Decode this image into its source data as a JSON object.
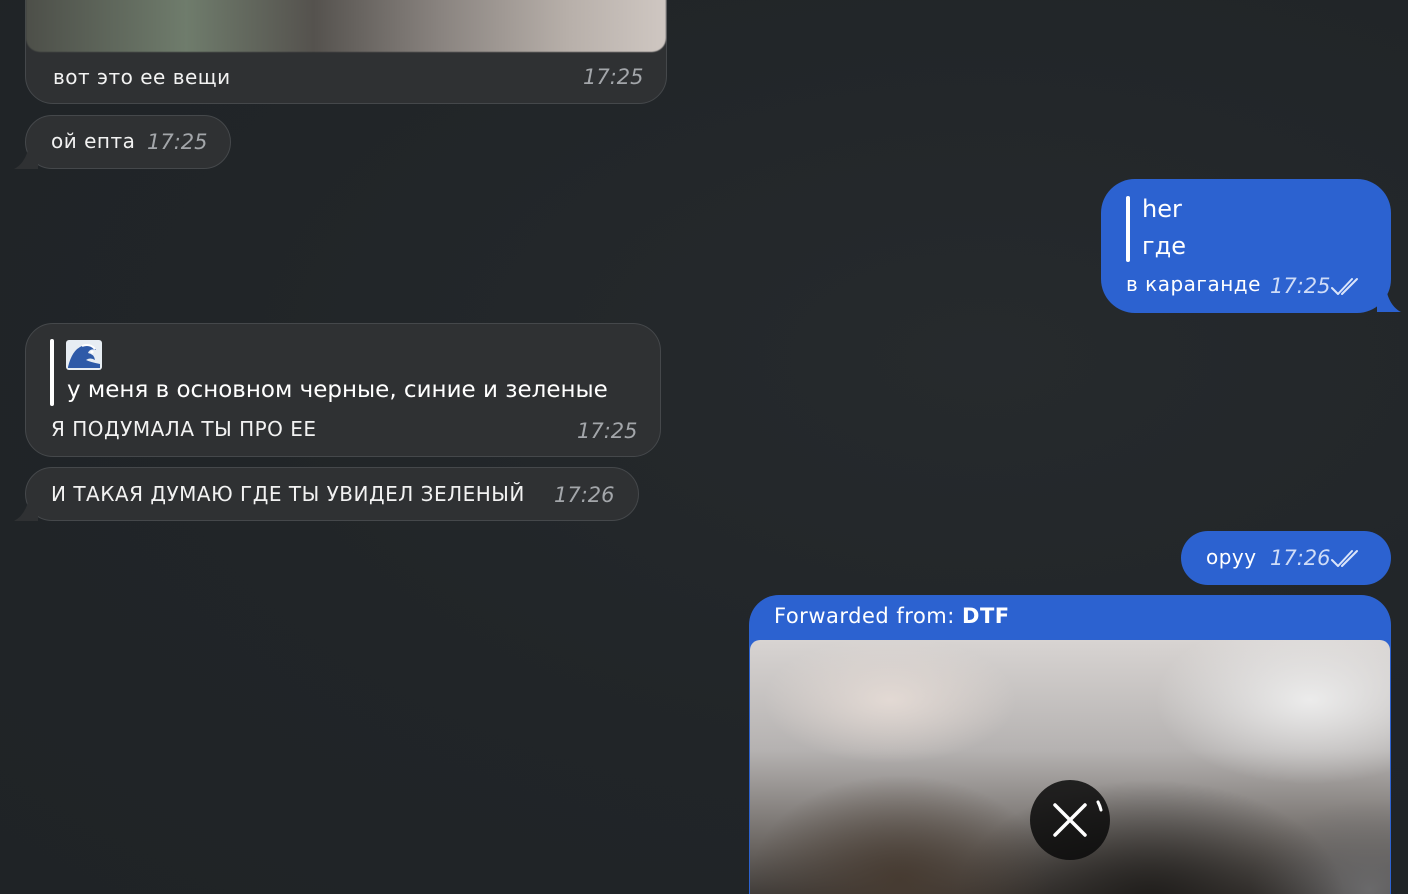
{
  "messages": {
    "m1": {
      "text": "вот это ее вещи",
      "time": "17:25"
    },
    "m2": {
      "text": "ой епта",
      "time": "17:25"
    },
    "m3": {
      "quote_title": "her",
      "quote_text": "где",
      "text": "в караганде",
      "time": "17:25"
    },
    "m4": {
      "quote_title": "🌊",
      "quote_text": "у меня в основном черные, синие и зеленые",
      "text": "Я ПОДУМАЛА ТЫ ПРО ЕЕ",
      "time": "17:25"
    },
    "m5": {
      "text": "И ТАКАЯ ДУМАЮ ГДЕ ТЫ УВИДЕЛ ЗЕЛЕНЫЙ",
      "time": "17:26"
    },
    "m6": {
      "text": "оруу",
      "time": "17:26"
    },
    "m7": {
      "forward_label": "Forwarded from:",
      "forward_source": "DTF"
    }
  },
  "icons": {
    "read_checks": "double-check-icon",
    "cancel": "close-icon",
    "wave": "water-wave-emoji"
  },
  "colors": {
    "background": "#222629",
    "incoming_bubble": "#2f3133",
    "outgoing_bubble": "#2c62d0"
  }
}
